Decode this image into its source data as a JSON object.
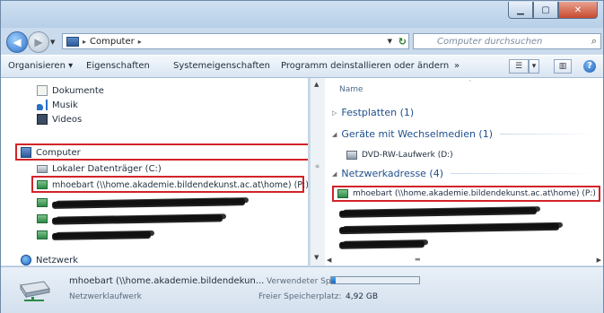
{
  "address_bar": {
    "crumb": "Computer",
    "separator": "▸"
  },
  "search": {
    "placeholder": "Computer durchsuchen"
  },
  "toolbar": {
    "organize": "Organisieren ▾",
    "properties": "Eigenschaften",
    "system_properties": "Systemeigenschaften",
    "uninstall": "Programm deinstallieren oder ändern",
    "more": "»"
  },
  "nav_pane": {
    "libraries": [
      "Dokumente",
      "Musik",
      "Videos"
    ],
    "computer": "Computer",
    "local_disk": "Lokaler Datenträger (C:)",
    "mapped_drive": "mhoebart (\\\\home.akademie.bildendekunst.ac.at\\home) (P:)",
    "network": "Netzwerk"
  },
  "content": {
    "column_header": "Name",
    "groups": [
      {
        "label": "Festplatten (1)",
        "expanded": false
      },
      {
        "label": "Geräte mit Wechselmedien (1)",
        "expanded": true
      },
      {
        "label": "Netzwerkadresse (4)",
        "expanded": true
      }
    ],
    "dvd_drive": "DVD-RW-Laufwerk (D:)",
    "mapped_drive": "mhoebart (\\\\home.akademie.bildendekunst.ac.at\\home) (P:)"
  },
  "details": {
    "name": "mhoebart (\\\\home.akademie.bildendekun...",
    "type": "Netzwerklaufwerk",
    "used_label": "Verwendeter Speic...",
    "free_label": "Freier Speicherplatz:",
    "free_value": "4,92 GB",
    "used_fraction": 0.05
  },
  "colors": {
    "highlight": "#d2232a",
    "group_text": "#1e4f8c",
    "accent": "#1a6bc4"
  }
}
